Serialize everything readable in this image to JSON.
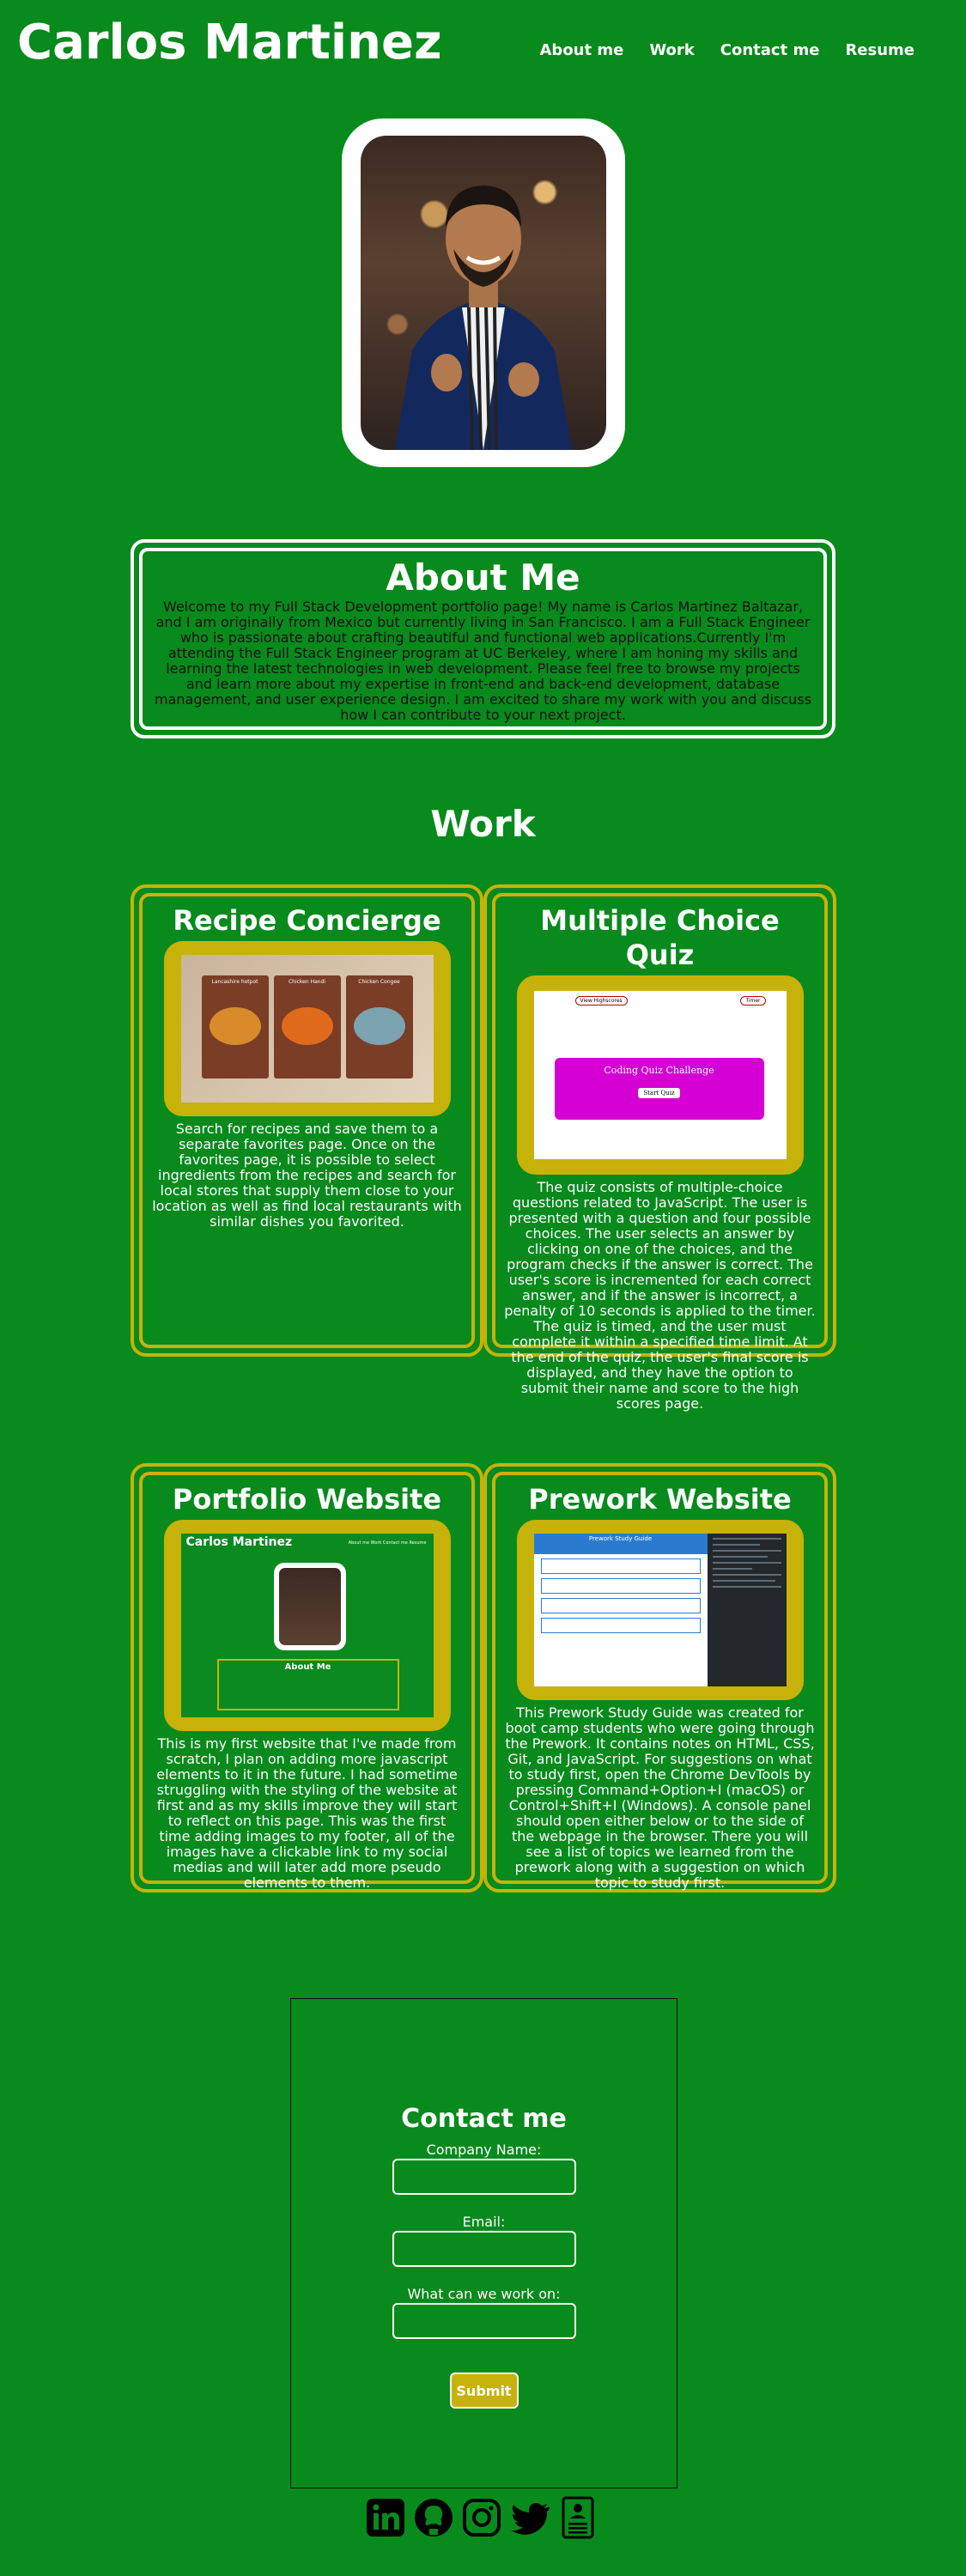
{
  "header": {
    "title": "Carlos Martinez",
    "nav": [
      "About me",
      "Work",
      "Contact me",
      "Resume"
    ]
  },
  "about": {
    "heading": "About Me",
    "text": "Welcome to my Full Stack Development portfolio page! My name is Carlos Martinez Baltazar, and I am originally from Mexico but currently living in San Francisco. I am a Full Stack Engineer who is passionate about crafting beautiful and functional web applications.Currently I'm attending the Full Stack Engineer program at UC Berkeley, where I am honing my skills and learning the latest technologies in web development. Please feel free to browse my projects and learn more about my expertise in front-end and back-end development, database management, and user experience design. I am excited to share my work with you and discuss how I can contribute to your next project."
  },
  "work": {
    "heading": "Work",
    "projects": [
      {
        "title": "Recipe Concierge",
        "description": "Search for recipes and save them to a separate favorites page. Once on the favorites page, it is possible to select ingredients from the recipes and search for local stores that supply them close to your location as well as find local restaurants with similar dishes you favorited.",
        "thumb_labels": [
          "Lancashire hotpot",
          "Chicken Handi",
          "Chicken Congee"
        ]
      },
      {
        "title": "Multiple Choice Quiz",
        "description": "The quiz consists of multiple-choice questions related to JavaScript. The user is presented with a question and four possible choices. The user selects an answer by clicking on one of the choices, and the program checks if the answer is correct. The user's score is incremented for each correct answer, and if the answer is incorrect, a penalty of 10 seconds is applied to the timer. The quiz is timed, and the user must complete it within a specified time limit. At the end of the quiz, the user's final score is displayed, and they have the option to submit their name and score to the high scores page.",
        "thumb_labels": [
          "View Highscores",
          "Timer",
          "Coding Quiz Challenge",
          "Start Quiz"
        ]
      },
      {
        "title": "Portfolio Website",
        "description": "This is my first website that I've made from scratch, I plan on adding more javascript elements to it in the future. I had sometime struggling with the styling of the website at first and as my skills improve they will start to reflect on this page. This was the first time adding images to my footer, all of the images have a clickable link to my social medias and will later add more pseudo elements to them.",
        "thumb_labels": [
          "Carlos Martinez",
          "About me  Work  Contact me  Resume",
          "About Me"
        ]
      },
      {
        "title": "Prework Website",
        "description": "This Prework Study Guide was created for boot camp students who were going through the Prework. It contains notes on HTML, CSS, Git, and JavaScript. For suggestions on what to study first, open the Chrome DevTools by pressing Command+Option+I (macOS) or Control+Shift+I (Windows). A console panel should open either below or to the side of the webpage in the browser. There you will see a list of topics we learned from the prework along with a suggestion on which topic to study first.",
        "thumb_labels": [
          "Prework Study Guide"
        ]
      }
    ]
  },
  "contact": {
    "heading": "Contact me",
    "fields": [
      {
        "label": "Company Name:",
        "value": ""
      },
      {
        "label": "Email:",
        "value": ""
      },
      {
        "label": "What can we work on:",
        "value": ""
      }
    ],
    "submit_label": "Submit"
  },
  "socials": [
    "linkedin-icon",
    "github-icon",
    "instagram-icon",
    "twitter-icon",
    "resume-icon"
  ],
  "colors": {
    "background": "#088a1d",
    "accent": "#c7b20a",
    "text": "#ffffff"
  }
}
